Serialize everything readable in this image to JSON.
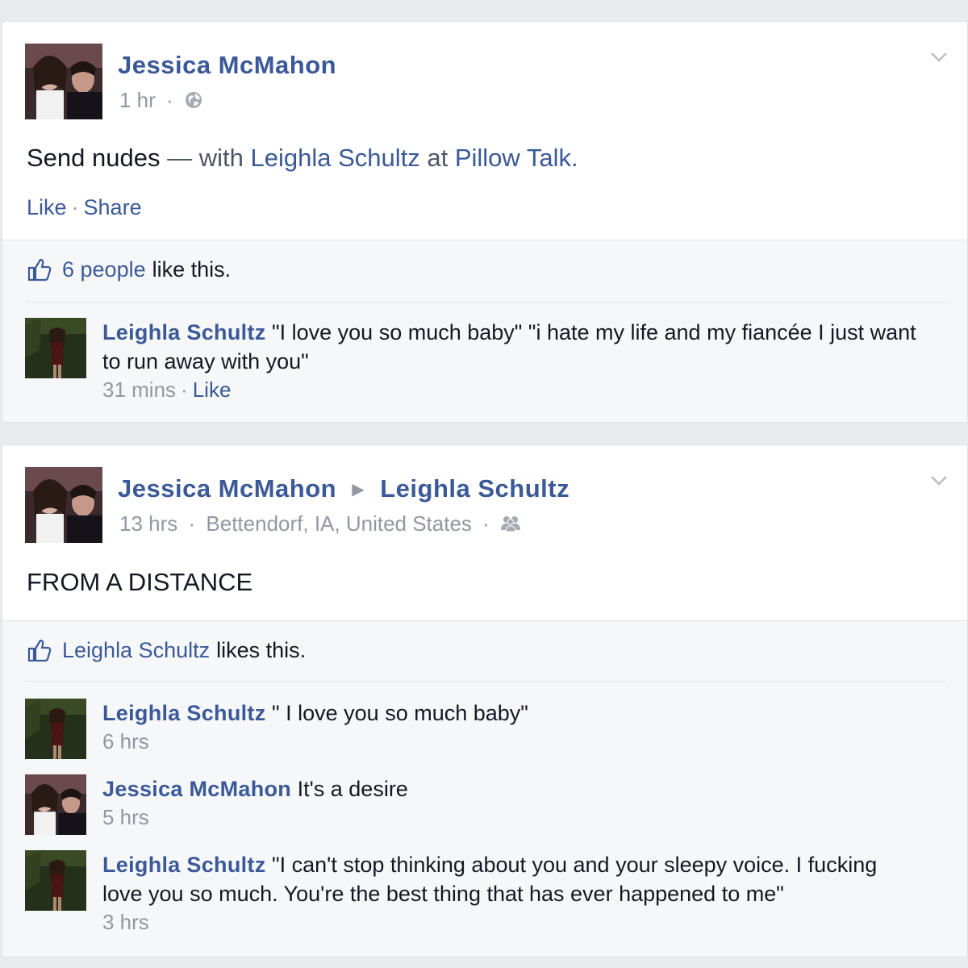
{
  "colors": {
    "link": "#3b5998",
    "meta": "#9197a3",
    "text": "#141823",
    "background": "#e9ebee",
    "ufi_background": "#f6f7f9"
  },
  "post1": {
    "author": "Jessica McMahon",
    "time": "1 hr",
    "privacy_icon": "globe-icon",
    "text": "Send nudes",
    "with_text": "— with",
    "tagged_person": "Leighla Schultz",
    "at_text": "at",
    "place": "Pillow Talk",
    "period": ".",
    "actions": {
      "like": "Like",
      "share": "Share"
    },
    "likes": {
      "icon": "thumbs-up-icon",
      "count_link": "6 people",
      "suffix": "like this."
    },
    "comments": [
      {
        "author": "Leighla Schultz",
        "text": "\"I love you so much baby\" \"i hate my life and my fiancée I just want to run away with you\"",
        "time": "31 mins",
        "like": "Like"
      }
    ]
  },
  "post2": {
    "author": "Jessica McMahon",
    "arrow": "▶",
    "target": "Leighla Schultz",
    "time": "13 hrs",
    "location": "Bettendorf, IA, United States",
    "privacy_icon": "friends-icon",
    "text": "FROM A DISTANCE",
    "likes": {
      "icon": "thumbs-up-icon",
      "count_link": "Leighla Schultz",
      "suffix": "likes this."
    },
    "comments": [
      {
        "author": "Leighla Schultz",
        "text": "\" I love you so much baby\"",
        "time": "6 hrs"
      },
      {
        "author": "Jessica McMahon",
        "text": "It's a desire",
        "time": "5 hrs"
      },
      {
        "author": "Leighla Schultz",
        "text": "\"I can't stop thinking about you and your sleepy voice. I fucking love you so much. You're the best thing that has ever happened to me\"",
        "time": "3 hrs"
      }
    ]
  }
}
